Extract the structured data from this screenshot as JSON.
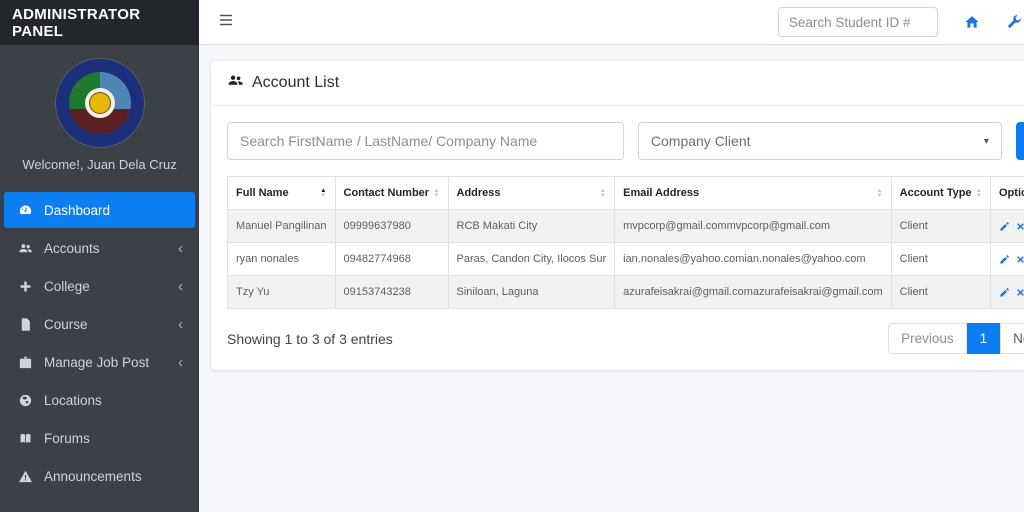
{
  "sidebar": {
    "brand": "ADMINISTRATOR PANEL",
    "logo_title": "LAGUNA STATE POLYTECHNIC UNIVERSITY 1952",
    "welcome": "Welcome!, Juan Dela Cruz",
    "items": [
      {
        "label": "Dashboard",
        "icon": "tachometer-icon",
        "active": true,
        "has_submenu": false
      },
      {
        "label": "Accounts",
        "icon": "users-icon",
        "active": false,
        "has_submenu": true
      },
      {
        "label": "College",
        "icon": "plus-icon",
        "active": false,
        "has_submenu": true
      },
      {
        "label": "Course",
        "icon": "file-icon",
        "active": false,
        "has_submenu": true
      },
      {
        "label": "Manage Job Post",
        "icon": "briefcase-icon",
        "active": false,
        "has_submenu": true
      },
      {
        "label": "Locations",
        "icon": "globe-icon",
        "active": false,
        "has_submenu": false
      },
      {
        "label": "Forums",
        "icon": "book-icon",
        "active": false,
        "has_submenu": false
      },
      {
        "label": "Announcements",
        "icon": "warning-icon",
        "active": false,
        "has_submenu": false
      }
    ],
    "chevron_glyph": "‹"
  },
  "topbar": {
    "search_placeholder": "Search Student ID #",
    "icons": [
      "home-icon",
      "wrench-icon",
      "edit-icon"
    ]
  },
  "card": {
    "title": "Account List",
    "filter": {
      "search_placeholder": "Search FirstName / LastName/ Company Name",
      "account_type_selected": "Company Client",
      "select_caret": "▾"
    },
    "table": {
      "columns": [
        "Full Name",
        "Contact Number",
        "Address",
        "Email Address",
        "Account Type",
        "Option"
      ],
      "sorted_column": "Full Name",
      "sort_direction": "asc",
      "rows": [
        {
          "full_name": "Manuel Pangilinan",
          "contact": "09999637980",
          "address": "RCB Makati City",
          "email": "mvpcorp@gmail.commvpcorp@gmail.com",
          "type": "Client"
        },
        {
          "full_name": "ryan nonales",
          "contact": "09482774968",
          "address": "Paras, Candon City, Ilocos Sur",
          "email": "ian.nonales@yahoo.comian.nonales@yahoo.com",
          "type": "Client"
        },
        {
          "full_name": "Tzy Yu",
          "contact": "09153743238",
          "address": "Siniloan, Laguna",
          "email": "azurafeisakrai@gmail.comazurafeisakrai@gmail.com",
          "type": "Client"
        }
      ]
    },
    "footer": {
      "showing": "Showing 1 to 3 of 3 entries",
      "pagination": {
        "previous": "Previous",
        "current_page": "1",
        "next": "Next"
      }
    }
  },
  "colors": {
    "accent": "#0d7ef2",
    "sidebar_bg": "#3b4147",
    "sidebar_header_bg": "#23272b",
    "body_bg": "#f4f6f9",
    "table_stripe": "#f2f2f2",
    "icon_blue": "#1a73e8"
  }
}
